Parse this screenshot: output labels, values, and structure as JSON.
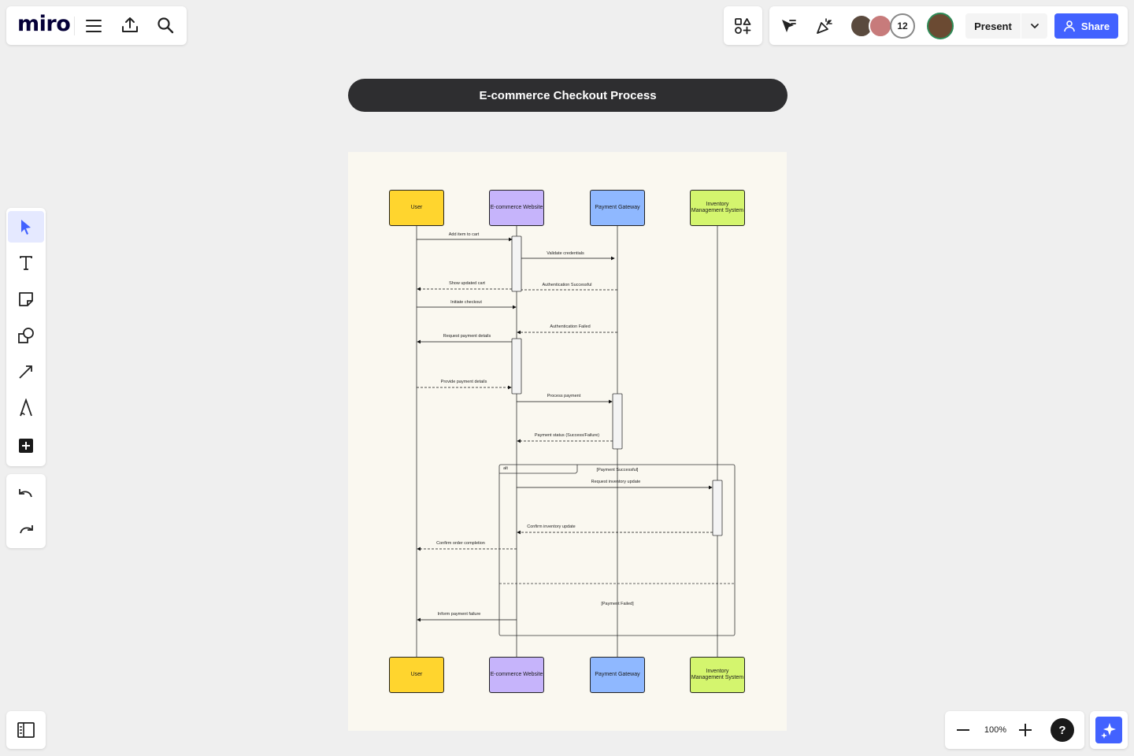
{
  "app": {
    "logo": "miro"
  },
  "topbar_right": {
    "collaborator_count": "12",
    "present_label": "Present",
    "share_label": "Share"
  },
  "board": {
    "title": "E-commerce Checkout Process"
  },
  "diagram": {
    "actors": [
      "User",
      "E-commerce Website",
      "Payment Gateway",
      "Inventory Management System"
    ],
    "actor_colors": [
      "#ffd52e",
      "#c6b4fb",
      "#8fb8ff",
      "#d4f56e"
    ],
    "messages": {
      "m1": "Add item to cart",
      "m2": "Validate credentials",
      "m3": "Show updated cart",
      "m4": "Authentication Successful",
      "m5": "Initiate checkout",
      "m6": "Authentication Failed",
      "m7": "Request payment details",
      "m8": "Provide payment details",
      "m9": "Process payment",
      "m10": "Payment status (Success/Failure)",
      "m11": "Request inventory update",
      "m12": "Confirm inventory update",
      "m13": "Confirm order completion",
      "m14": "Inform payment failure"
    },
    "alt_fragment": {
      "label": "alt",
      "guard_success": "[Payment Successful]",
      "guard_failed": "[Payment Failed]"
    }
  },
  "zoom": {
    "level": "100%"
  },
  "help": {
    "label": "?"
  }
}
